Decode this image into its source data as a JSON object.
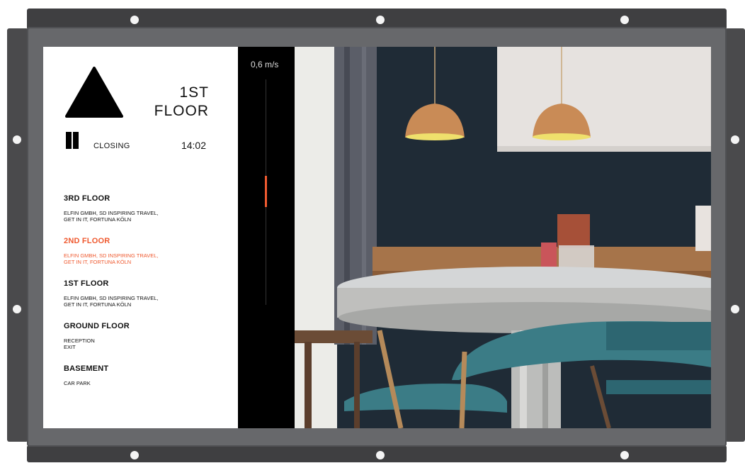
{
  "display": {
    "current_floor": "1ST\nFLOOR",
    "door_status": "CLOSING",
    "time": "14:02",
    "direction": "up-arrow-icon",
    "speed_label": "0,6 m/s",
    "accent_color": "#ef5a30"
  },
  "floors": [
    {
      "name": "3RD FLOOR",
      "tenants": "ELFIN GMBH, SD INSPIRING TRAVEL,\nGET IN IT, FORTUNA KÖLN",
      "active": false
    },
    {
      "name": "2ND FLOOR",
      "tenants": "ELFIN GMBH, SD INSPIRING TRAVEL,\nGET IN IT, FORTUNA KÖLN",
      "active": true
    },
    {
      "name": "1ST FLOOR",
      "tenants": "ELFIN GMBH, SD INSPIRING TRAVEL,\nGET IN IT, FORTUNA KÖLN",
      "active": false
    },
    {
      "name": "GROUND FLOOR",
      "tenants": "RECEPTION\nEXIT",
      "active": false
    },
    {
      "name": "BASEMENT",
      "tenants": "CAR PARK",
      "active": false
    }
  ]
}
